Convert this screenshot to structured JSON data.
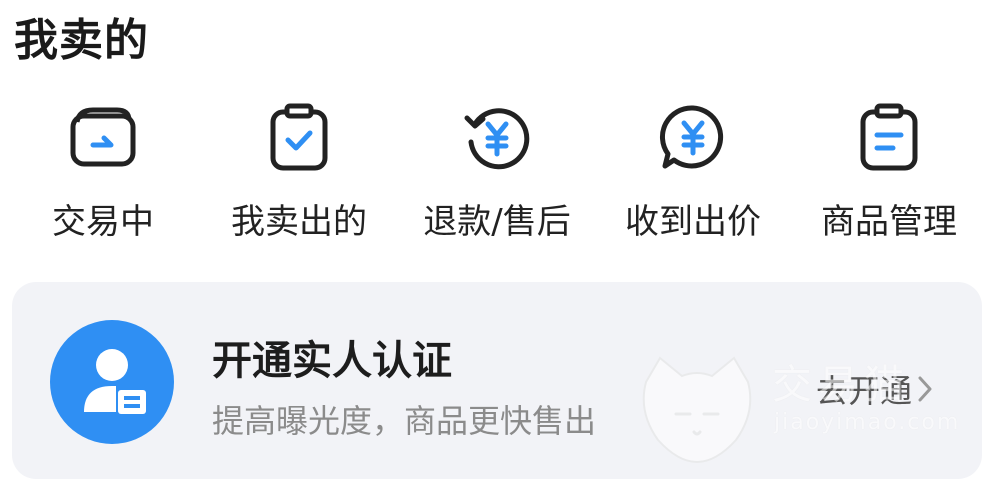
{
  "section": {
    "title": "我卖的"
  },
  "shortcuts": [
    {
      "label": "交易中",
      "icon": "wallet-arrow-icon"
    },
    {
      "label": "我卖出的",
      "icon": "clipboard-check-icon"
    },
    {
      "label": "退款/售后",
      "icon": "refund-yen-icon"
    },
    {
      "label": "收到出价",
      "icon": "offer-yen-bubble-icon"
    },
    {
      "label": "商品管理",
      "icon": "clipboard-list-icon"
    }
  ],
  "verify_card": {
    "title": "开通实人认证",
    "subtitle": "提高曝光度，商品更快售出",
    "action": "去开通",
    "icon": "id-card-person-icon"
  },
  "watermark": {
    "text": "交易猫",
    "url": "jiaoyimao.com"
  },
  "colors": {
    "accent_blue": "#2f8ff3",
    "icon_stroke": "#222222",
    "card_bg": "#f2f3f7"
  }
}
